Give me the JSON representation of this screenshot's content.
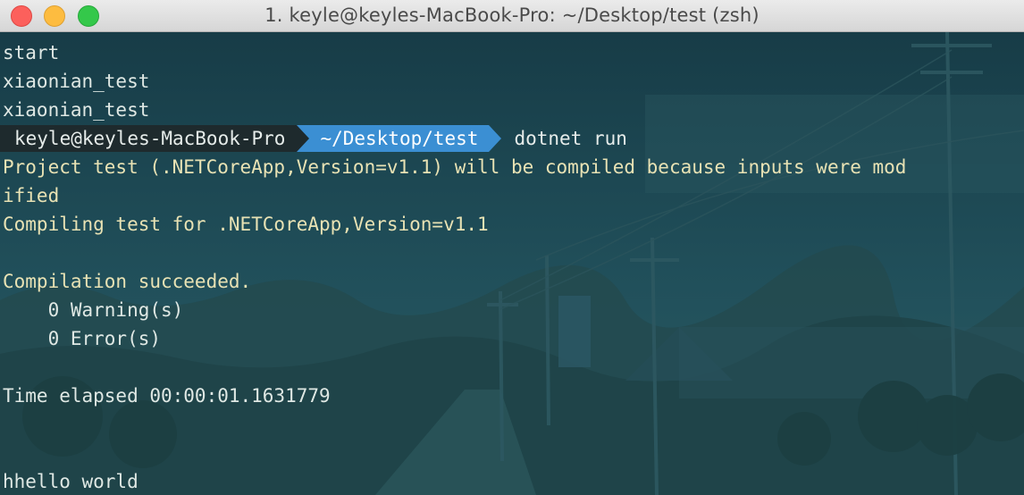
{
  "window": {
    "title": "1. keyle@keyles-MacBook-Pro: ~/Desktop/test (zsh)"
  },
  "colors": {
    "prompt_user_bg": "#1e2a2d",
    "prompt_path_bg": "#3b8fd3",
    "output_text": "#dfe8e4",
    "highlight_text": "#e8e2b4"
  },
  "terminal": {
    "pre_lines": [
      "start",
      "xiaonian_test",
      "xiaonian_test"
    ],
    "prompt": {
      "user": "keyle@keyles-MacBook-Pro",
      "path": "~/Desktop/test",
      "command": "dotnet run"
    },
    "output": {
      "compile_notice_1": "Project test (.NETCoreApp,Version=v1.1) will be compiled because inputs were mod",
      "compile_notice_2": "ified",
      "compiling": "Compiling test for .NETCoreApp,Version=v1.1",
      "succeeded": "Compilation succeeded.",
      "warnings": "    0 Warning(s)",
      "errors": "    0 Error(s)",
      "elapsed": "Time elapsed 00:00:01.1631779",
      "result": "hhello world"
    }
  }
}
